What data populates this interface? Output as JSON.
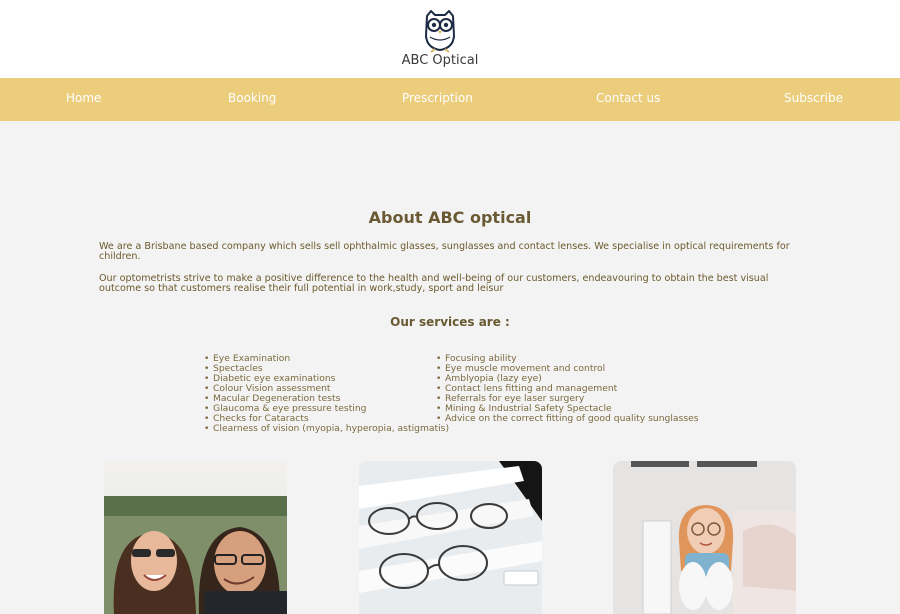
{
  "header": {
    "logo_icon": "owl-logo-icon",
    "brand": "ABC Optical"
  },
  "nav": {
    "items": [
      {
        "label": "Home"
      },
      {
        "label": "Booking"
      },
      {
        "label": "Prescription"
      },
      {
        "label": "Contact us"
      },
      {
        "label": "Subscribe"
      }
    ]
  },
  "about": {
    "title": "About ABC optical",
    "paragraph1": "We are a Brisbane based company which sells sell ophthalmic glasses, sunglasses and contact lenses. We specialise in optical requirements for children.",
    "paragraph2": "Our optometrists strive to make a positive difference to the health and well-being of our customers, endeavouring to obtain the best visual outcome so that customers realise their full potential in work,study, sport and leisur"
  },
  "services": {
    "title": "Our services are :",
    "left": [
      "Eye Examination",
      "Spectacles",
      "Diabetic eye examinations",
      "Colour Vision assessment",
      "Macular Degeneration tests",
      "Glaucoma & eye pressure testing",
      "Checks for Cataracts",
      "Clearness of vision (myopia, hyperopia, astigmatis)"
    ],
    "right": [
      "Focusing ability",
      "Eye muscle movement and control",
      "Amblyopia (lazy eye)",
      "Contact lens fitting and management",
      "Referrals for eye laser surgery",
      "Mining & Industrial Safety Spectacle",
      "Advice on the correct fitting of good quality sunglasses"
    ]
  },
  "colors": {
    "nav_bg": "#ebcd7c",
    "page_bg": "#f3f3f3",
    "text": "#6b5a2c"
  }
}
